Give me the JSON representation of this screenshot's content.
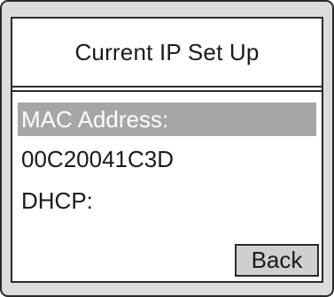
{
  "screen": {
    "title": "Current IP Set Up",
    "items": [
      {
        "label": "MAC Address:",
        "selected": true
      },
      {
        "label": "00C20041C3D",
        "selected": false
      },
      {
        "label": "DHCP:",
        "selected": false
      }
    ],
    "back_label": "Back"
  },
  "colors": {
    "frame_background": "#dcdcdc",
    "screen_background": "#ffffff",
    "highlight": "#a6a6a6",
    "button_background": "#cfcfcf",
    "border": "#2a2a2a"
  }
}
